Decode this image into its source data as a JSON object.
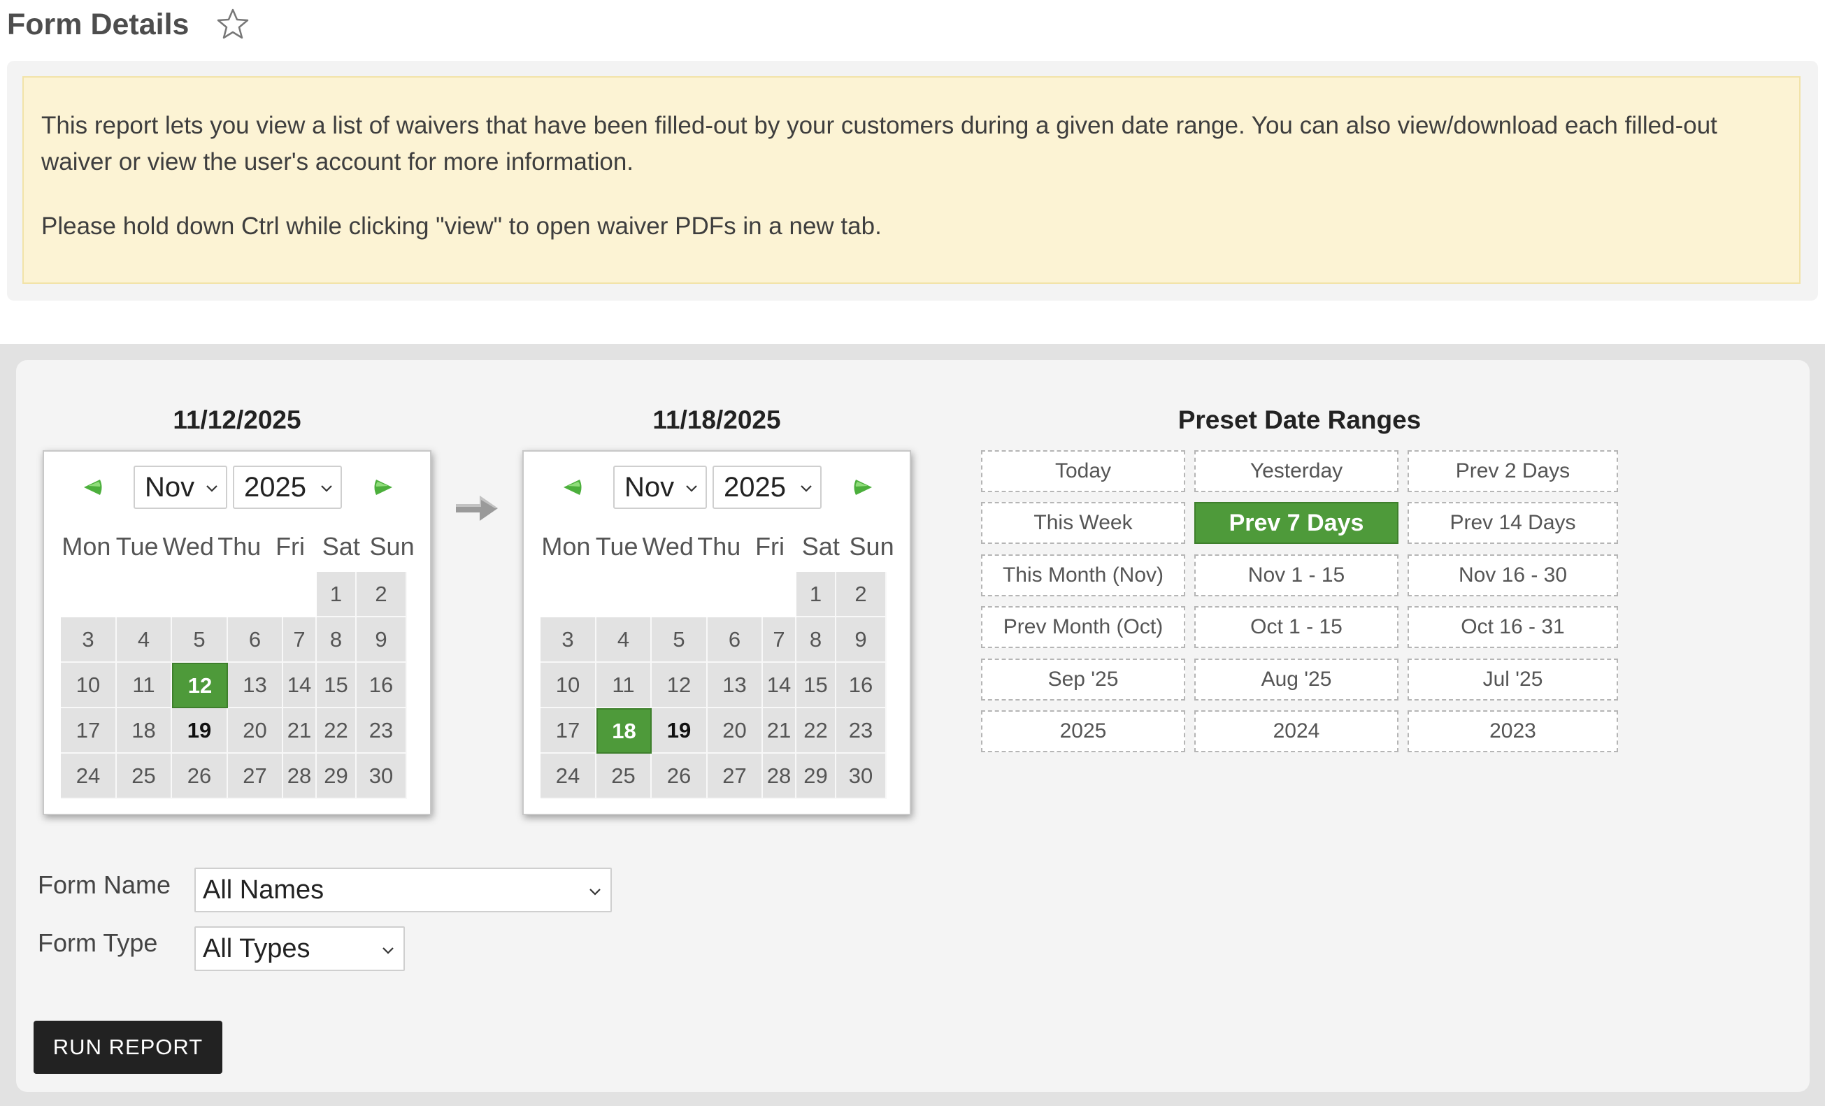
{
  "header": {
    "title": "Form Details",
    "favorite_icon": "star-outline-icon"
  },
  "info": {
    "paragraph1": "This report lets you view a list of waivers that have been filled-out by your customers during a given date range. You can also view/download each filled-out waiver or view the user's account for more information.",
    "paragraph2": "Please hold down Ctrl while clicking \"view\" to open waiver PDFs in a new tab."
  },
  "colors": {
    "accent_green": "#4e9a3a",
    "notice_bg": "#fcf3d4",
    "button_dark": "#222222"
  },
  "weekdays": [
    "Mon",
    "Tue",
    "Wed",
    "Thu",
    "Fri",
    "Sat",
    "Sun"
  ],
  "start_calendar": {
    "date_label": "11/12/2025",
    "month": "Nov",
    "year": "2025",
    "weeks": [
      [
        "",
        "",
        "",
        "",
        "",
        "1",
        "2"
      ],
      [
        "3",
        "4",
        "5",
        "6",
        "7",
        "8",
        "9"
      ],
      [
        "10",
        "11",
        "12",
        "13",
        "14",
        "15",
        "16"
      ],
      [
        "17",
        "18",
        "19",
        "20",
        "21",
        "22",
        "23"
      ],
      [
        "24",
        "25",
        "26",
        "27",
        "28",
        "29",
        "30"
      ]
    ],
    "selected_day": "12",
    "today_day": "19"
  },
  "end_calendar": {
    "date_label": "11/18/2025",
    "month": "Nov",
    "year": "2025",
    "weeks": [
      [
        "",
        "",
        "",
        "",
        "",
        "1",
        "2"
      ],
      [
        "3",
        "4",
        "5",
        "6",
        "7",
        "8",
        "9"
      ],
      [
        "10",
        "11",
        "12",
        "13",
        "14",
        "15",
        "16"
      ],
      [
        "17",
        "18",
        "19",
        "20",
        "21",
        "22",
        "23"
      ],
      [
        "24",
        "25",
        "26",
        "27",
        "28",
        "29",
        "30"
      ]
    ],
    "selected_day": "18",
    "today_day": "19"
  },
  "presets": {
    "title": "Preset Date Ranges",
    "items": [
      {
        "label": "Today",
        "active": false
      },
      {
        "label": "Yesterday",
        "active": false
      },
      {
        "label": "Prev 2 Days",
        "active": false
      },
      {
        "label": "This Week",
        "active": false
      },
      {
        "label": "Prev 7 Days",
        "active": true
      },
      {
        "label": "Prev 14 Days",
        "active": false
      },
      {
        "label": "This Month (Nov)",
        "active": false
      },
      {
        "label": "Nov 1 - 15",
        "active": false
      },
      {
        "label": "Nov 16 - 30",
        "active": false
      },
      {
        "label": "Prev Month (Oct)",
        "active": false
      },
      {
        "label": "Oct 1 - 15",
        "active": false
      },
      {
        "label": "Oct 16 - 31",
        "active": false
      },
      {
        "label": "Sep '25",
        "active": false
      },
      {
        "label": "Aug '25",
        "active": false
      },
      {
        "label": "Jul '25",
        "active": false
      },
      {
        "label": "2025",
        "active": false
      },
      {
        "label": "2024",
        "active": false
      },
      {
        "label": "2023",
        "active": false
      }
    ]
  },
  "filters": {
    "form_name_label": "Form Name",
    "form_name_value": "All Names",
    "form_type_label": "Form Type",
    "form_type_value": "All Types"
  },
  "actions": {
    "run_report_label": "RUN REPORT"
  }
}
